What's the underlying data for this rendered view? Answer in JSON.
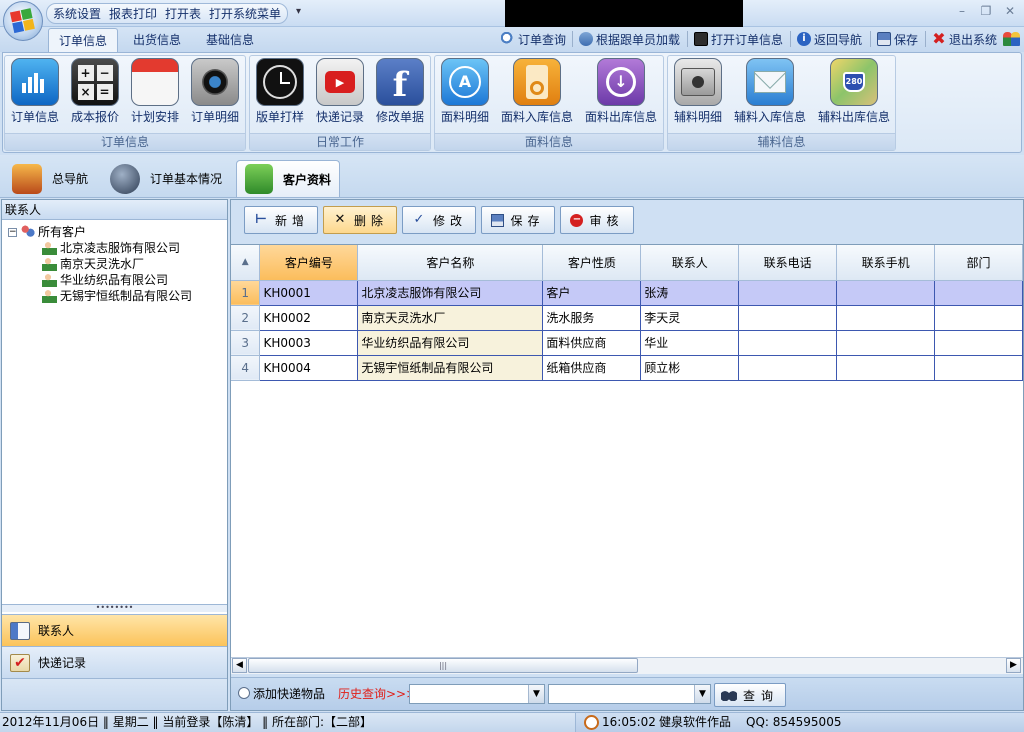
{
  "title_bar": {
    "quick_access": [
      "系统设置",
      "报表打印",
      "打开表",
      "打开系统菜单"
    ],
    "customize_arrow": "▾",
    "window_controls": {
      "minimize": "–",
      "restore": "❐",
      "close": "✕"
    }
  },
  "main_tabs": [
    {
      "label": "订单信息",
      "active": true
    },
    {
      "label": "出货信息",
      "active": false
    },
    {
      "label": "基础信息",
      "active": false
    }
  ],
  "right_toolbar": [
    {
      "label": "订单查询",
      "icon": "search-icon"
    },
    {
      "label": "根据跟单员加载",
      "icon": "user-search-icon"
    },
    {
      "label": "打开订单信息",
      "icon": "open-icon"
    },
    {
      "label": "返回导航",
      "icon": "info-icon"
    },
    {
      "label": "保存",
      "icon": "save-icon"
    },
    {
      "label": "退出系统",
      "icon": "exit-icon"
    }
  ],
  "ribbon_groups": [
    {
      "name": "订单信息",
      "buttons": [
        "订单信息",
        "成本报价",
        "计划安排",
        "订单明细"
      ]
    },
    {
      "name": "日常工作",
      "buttons": [
        "版单打样",
        "快递记录",
        "修改单据"
      ]
    },
    {
      "name": "面料信息",
      "buttons": [
        "面料明细",
        "面料入库信息",
        "面料出库信息"
      ]
    },
    {
      "name": "辅料信息",
      "buttons": [
        "辅料明细",
        "辅料入库信息",
        "辅料出库信息"
      ]
    }
  ],
  "nav_tabs": [
    {
      "label": "总导航",
      "active": false
    },
    {
      "label": "订单基本情况",
      "active": false
    },
    {
      "label": "客户资料",
      "active": true
    }
  ],
  "left_panel": {
    "header": "联系人",
    "tree_root": "所有客户",
    "tree_items": [
      "北京凌志服饰有限公司",
      "南京天灵洗水厂",
      "华业纺织品有限公司",
      "无锡宇恒纸制品有限公司"
    ],
    "splitter_dots": "••••••••",
    "nav_items": [
      {
        "label": "联系人",
        "active": true
      },
      {
        "label": "快递记录",
        "active": false
      }
    ]
  },
  "toolbar": {
    "add": "新增",
    "delete": "删除",
    "edit": "修改",
    "save": "保存",
    "audit": "审核"
  },
  "grid": {
    "columns": [
      "客户编号",
      "客户名称",
      "客户性质",
      "联系人",
      "联系电话",
      "联系手机",
      "部门"
    ],
    "sort_indicator": "▲",
    "selected_row": 0,
    "rows": [
      {
        "no": "1",
        "code": "KH0001",
        "name": "北京凌志服饰有限公司",
        "type": "客户",
        "contact": "张涛",
        "phone": "",
        "mobile": "",
        "dept": ""
      },
      {
        "no": "2",
        "code": "KH0002",
        "name": "南京天灵洗水厂",
        "type": "洗水服务",
        "contact": "李天灵",
        "phone": "",
        "mobile": "",
        "dept": ""
      },
      {
        "no": "3",
        "code": "KH0003",
        "name": "华业纺织品有限公司",
        "type": "面料供应商",
        "contact": "华业",
        "phone": "",
        "mobile": "",
        "dept": ""
      },
      {
        "no": "4",
        "code": "KH0004",
        "name": "无锡宇恒纸制品有限公司",
        "type": "纸箱供应商",
        "contact": "顾立彬",
        "phone": "",
        "mobile": "",
        "dept": ""
      }
    ]
  },
  "scrollbar": {
    "left": "◀",
    "right": "▶",
    "thumb_grip": "|||"
  },
  "query_bar": {
    "radio_label": "添加快递物品",
    "history_label": "历史查询>>>",
    "combo1_value": "",
    "combo2_value": "",
    "query_button": "查询"
  },
  "status_bar": {
    "left": "2012年11月06日 ‖ 星期二 ‖ 当前登录【陈清】 ‖ 所在部门:【二部】",
    "time": "16:05:02",
    "credit": "健泉软件作品",
    "qq": "QQ: 854595005"
  },
  "colors": {
    "ribbon_bg": "#dbe8f6",
    "selected_row": "#c5c9f7",
    "highlight_orange": "#fbbd5c",
    "name_column_bg": "#f7f2dc",
    "history_red": "#e0201a"
  }
}
